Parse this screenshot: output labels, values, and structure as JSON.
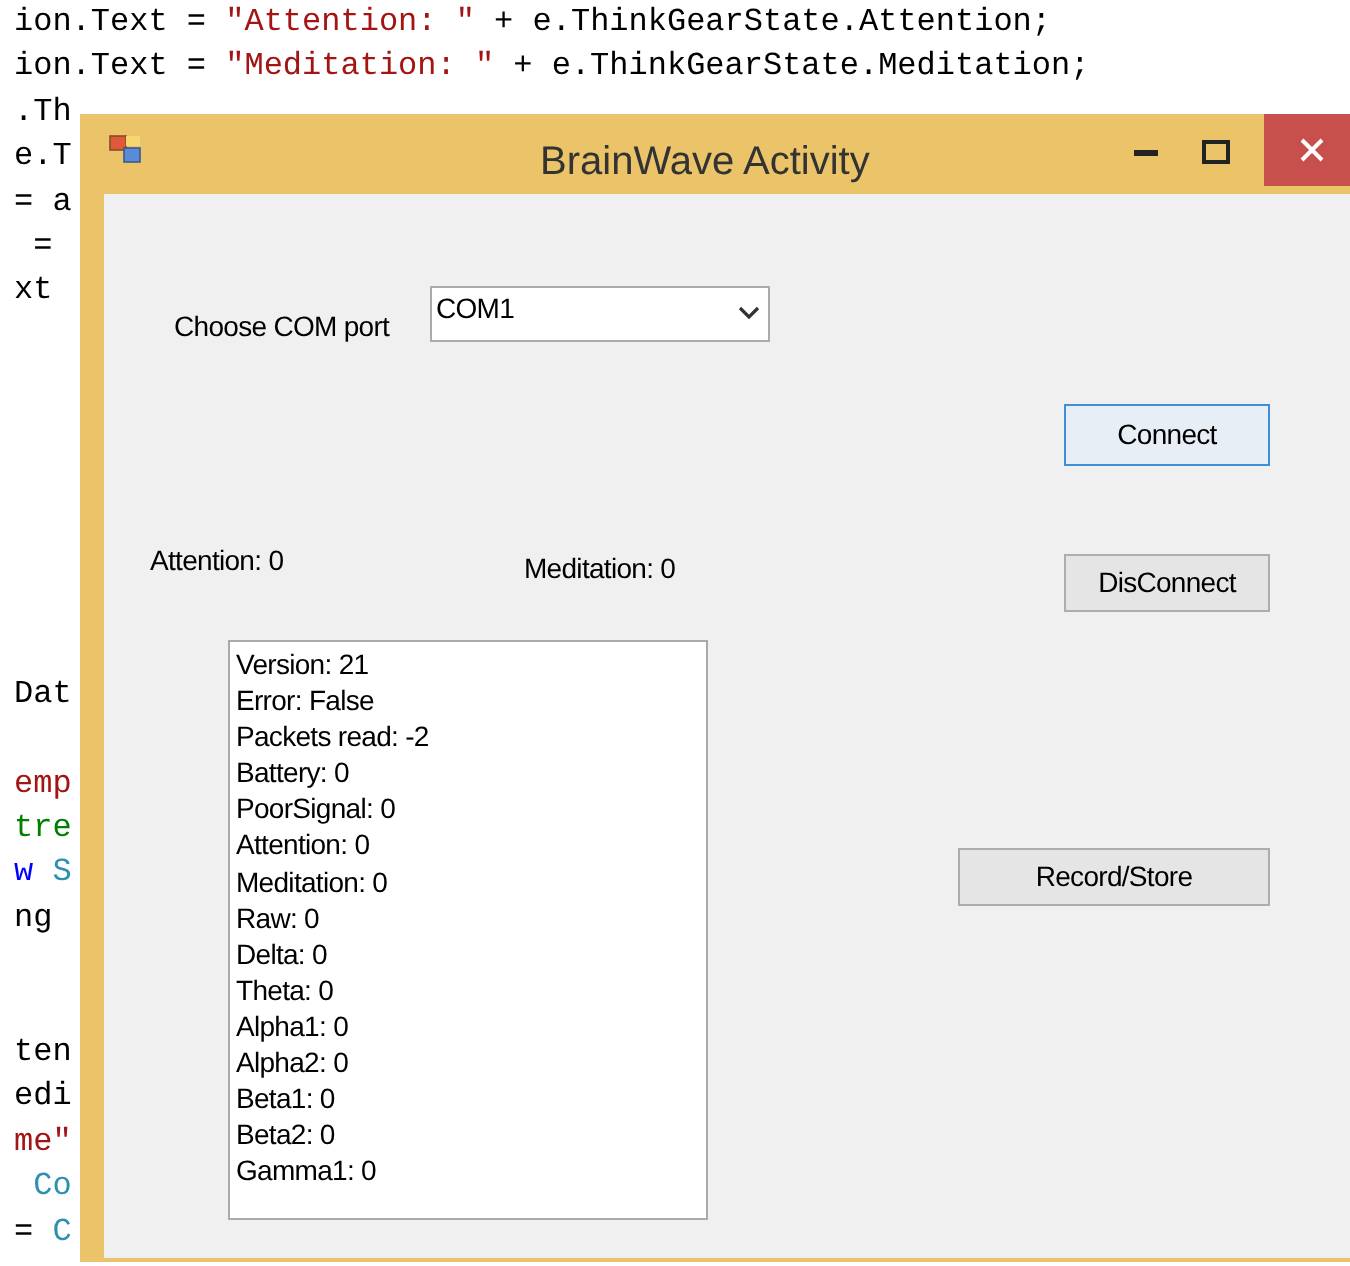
{
  "code_editor": {
    "lines": [
      {
        "segments": [
          {
            "kind": "plain",
            "text": "ion.Text = "
          },
          {
            "kind": "string",
            "text": "\"Attention: \""
          },
          {
            "kind": "plain",
            "text": " + e.ThinkGearState.Attention;"
          }
        ]
      },
      {
        "segments": [
          {
            "kind": "plain",
            "text": "ion.Text = "
          },
          {
            "kind": "string",
            "text": "\"Meditation: \""
          },
          {
            "kind": "plain",
            "text": " + e.ThinkGearState.Meditation;"
          }
        ]
      },
      {
        "segments": [
          {
            "kind": "plain",
            "text": ".Th"
          }
        ]
      },
      {
        "segments": [
          {
            "kind": "plain",
            "text": "e.T"
          }
        ]
      },
      {
        "segments": [
          {
            "kind": "plain",
            "text": "= a"
          }
        ]
      },
      {
        "segments": [
          {
            "kind": "plain",
            "text": " = "
          }
        ]
      },
      {
        "segments": [
          {
            "kind": "plain",
            "text": "xt"
          }
        ]
      },
      {
        "segments": [
          {
            "kind": "plain",
            "text": "Dat"
          }
        ]
      },
      {
        "segments": [
          {
            "kind": "string",
            "text": "emp"
          }
        ]
      },
      {
        "segments": [
          {
            "kind": "comment",
            "text": "tre"
          }
        ]
      },
      {
        "segments": [
          {
            "kind": "keyword",
            "text": "w"
          },
          {
            "kind": "type",
            "text": " S"
          }
        ]
      },
      {
        "segments": [
          {
            "kind": "plain",
            "text": "ng"
          }
        ]
      },
      {
        "segments": [
          {
            "kind": "plain",
            "text": "ten"
          }
        ]
      },
      {
        "segments": [
          {
            "kind": "plain",
            "text": "edi"
          }
        ]
      },
      {
        "segments": [
          {
            "kind": "string",
            "text": "me\""
          }
        ]
      },
      {
        "segments": [
          {
            "kind": "type",
            "text": " Co"
          }
        ]
      },
      {
        "segments": [
          {
            "kind": "plain",
            "text": "= "
          },
          {
            "kind": "type",
            "text": "C"
          }
        ]
      }
    ]
  },
  "window": {
    "title": "BrainWave Activity",
    "com_port": {
      "label": "Choose COM port",
      "value": "COM1"
    },
    "buttons": [
      {
        "label": "Connect",
        "focused": true
      },
      {
        "label": "DisConnect",
        "focused": false
      },
      {
        "label": "Record/Store",
        "focused": false
      }
    ],
    "attention": "Attention: 0",
    "meditation": "Meditation: 0",
    "readings": [
      "Version: 21",
      "Error: False",
      "Packets read: -2",
      "Battery: 0",
      "PoorSignal: 0",
      "Attention: 0",
      "Meditation: 0",
      "Raw: 0",
      "Delta: 0",
      "Theta: 0",
      "Alpha1: 0",
      "Alpha2: 0",
      "Beta1: 0",
      "Beta2: 0",
      "Gamma1: 0"
    ]
  }
}
